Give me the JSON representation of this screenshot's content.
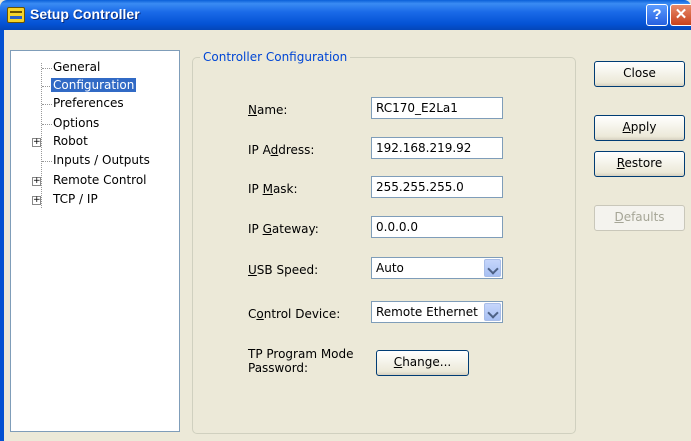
{
  "window": {
    "title": "Setup Controller",
    "help_glyph": "?",
    "close_glyph": "✕"
  },
  "tree": {
    "items": [
      {
        "label": "General"
      },
      {
        "label": "Configuration"
      },
      {
        "label": "Preferences"
      },
      {
        "label": "Options"
      },
      {
        "label": "Robot",
        "expander": "+"
      },
      {
        "label": "Inputs / Outputs"
      },
      {
        "label": "Remote Control",
        "expander": "+"
      },
      {
        "label": "TCP / IP",
        "expander": "+"
      }
    ],
    "selected": "Configuration"
  },
  "group": {
    "title": "Controller Configuration"
  },
  "form": {
    "name_label_u": "N",
    "name_label_rest": "ame:",
    "name_value": "RC170_E2La1",
    "ip_address_label_pre": "IP A",
    "ip_address_label_u": "d",
    "ip_address_label_post": "dress:",
    "ip_address_value": "192.168.219.92",
    "ip_mask_label_pre": "IP ",
    "ip_mask_label_u": "M",
    "ip_mask_label_post": "ask:",
    "ip_mask_value": "255.255.255.0",
    "ip_gateway_label_pre": "IP ",
    "ip_gateway_label_u": "G",
    "ip_gateway_label_post": "ateway:",
    "ip_gateway_value": "0.0.0.0",
    "usb_speed_label_u": "U",
    "usb_speed_label_rest": "SB Speed:",
    "usb_speed_value": "Auto",
    "control_device_label_pre": "C",
    "control_device_label_u": "o",
    "control_device_label_post": "ntrol Device:",
    "control_device_value": "Remote Ethernet",
    "tp_password_label_line1": "TP Program Mode",
    "tp_password_label_line2": "Password:",
    "change_button_u": "C",
    "change_button_rest": "hange..."
  },
  "buttons": {
    "close": "Close",
    "apply_u": "A",
    "apply_rest": "pply",
    "restore_u": "R",
    "restore_rest": "estore",
    "defaults_u": "D",
    "defaults_rest": "efaults"
  }
}
